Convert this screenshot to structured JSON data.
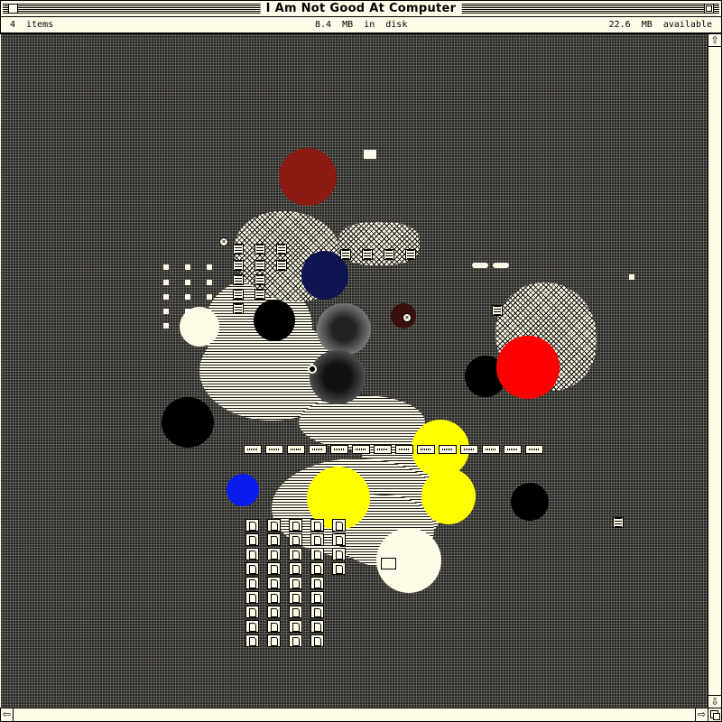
{
  "window": {
    "title": "I Am Not Good At Computer"
  },
  "infobar": {
    "items": "4  items",
    "disk": "8.4  MB  in  disk",
    "available": "22.6  MB  available"
  },
  "colors": {
    "desktop_pattern": "#2e2d2a",
    "cream": "#fefbe8",
    "dark_red": "#8b1a12",
    "navy": "#0d1450",
    "red": "#ff0000",
    "yellow": "#ffff00",
    "blue": "#0a1cf0",
    "black": "#000000"
  },
  "icons": {
    "close": "close-box-icon",
    "zoom": "zoom-box-icon",
    "scroll_up": "scroll-up-arrow-icon",
    "scroll_down": "scroll-down-arrow-icon",
    "scroll_left": "scroll-left-arrow-icon",
    "scroll_right": "scroll-right-arrow-icon",
    "grow": "grow-box-icon",
    "document": "document-icon",
    "folder_tag": "folder-tag-icon"
  },
  "scrollbars": {
    "up": "⇧",
    "down": "⇩",
    "left": "⇦",
    "right": "⇨"
  }
}
